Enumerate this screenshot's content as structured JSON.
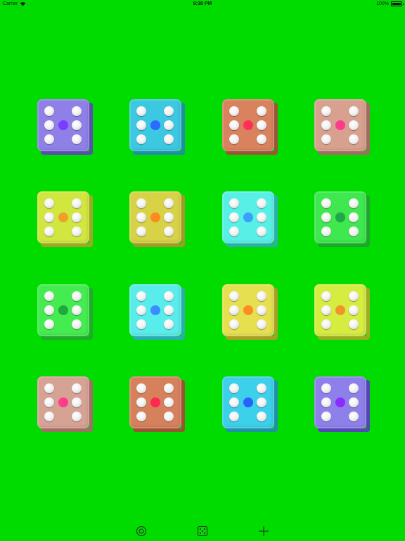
{
  "status_bar": {
    "carrier": "Carrier",
    "time": "9:38 PM",
    "battery": "100%"
  },
  "board": {
    "background_color": "#00dc00",
    "dice": [
      {
        "value": 6,
        "face_color": "#8f80e8",
        "side_color": "#5a4fb0",
        "center_color": "#7c3cff"
      },
      {
        "value": 6,
        "face_color": "#3cc8e0",
        "side_color": "#1f8fa3",
        "center_color": "#2a6cff"
      },
      {
        "value": 6,
        "face_color": "#d8825e",
        "side_color": "#9a5637",
        "center_color": "#ff2f5a"
      },
      {
        "value": 6,
        "face_color": "#d8a08e",
        "side_color": "#a06e60",
        "center_color": "#ff3c8a"
      },
      {
        "value": 6,
        "face_color": "#d2e640",
        "side_color": "#9aaa22",
        "center_color": "#f0a028"
      },
      {
        "value": 6,
        "face_color": "#d8d246",
        "side_color": "#a09a26",
        "center_color": "#ff8a1e"
      },
      {
        "value": 6,
        "face_color": "#58f0e6",
        "side_color": "#2ab2a8",
        "center_color": "#3aa0ff"
      },
      {
        "value": 6,
        "face_color": "#3ee84e",
        "side_color": "#1ea82a",
        "center_color": "#1ea84a"
      },
      {
        "value": 6,
        "face_color": "#44ec50",
        "side_color": "#22aa2c",
        "center_color": "#20a83c"
      },
      {
        "value": 6,
        "face_color": "#58ecea",
        "side_color": "#2aaeb0",
        "center_color": "#3a8cff"
      },
      {
        "value": 6,
        "face_color": "#e6e050",
        "side_color": "#a8a024",
        "center_color": "#ff8a26"
      },
      {
        "value": 6,
        "face_color": "#d6ec40",
        "side_color": "#9aae20",
        "center_color": "#f09628"
      },
      {
        "value": 6,
        "face_color": "#d6a294",
        "side_color": "#a06e62",
        "center_color": "#ff3c8a"
      },
      {
        "value": 6,
        "face_color": "#d6805c",
        "side_color": "#9a5434",
        "center_color": "#ff2850"
      },
      {
        "value": 6,
        "face_color": "#3cd0ea",
        "side_color": "#1e92a8",
        "center_color": "#2a60ff"
      },
      {
        "value": 6,
        "face_color": "#8e80ea",
        "side_color": "#5446b6",
        "center_color": "#8a2cff"
      }
    ]
  },
  "toolbar": {
    "items": [
      {
        "icon": "target-icon",
        "name": "settings"
      },
      {
        "icon": "dice-icon",
        "name": "roll"
      },
      {
        "icon": "plus-icon",
        "name": "add"
      }
    ]
  }
}
